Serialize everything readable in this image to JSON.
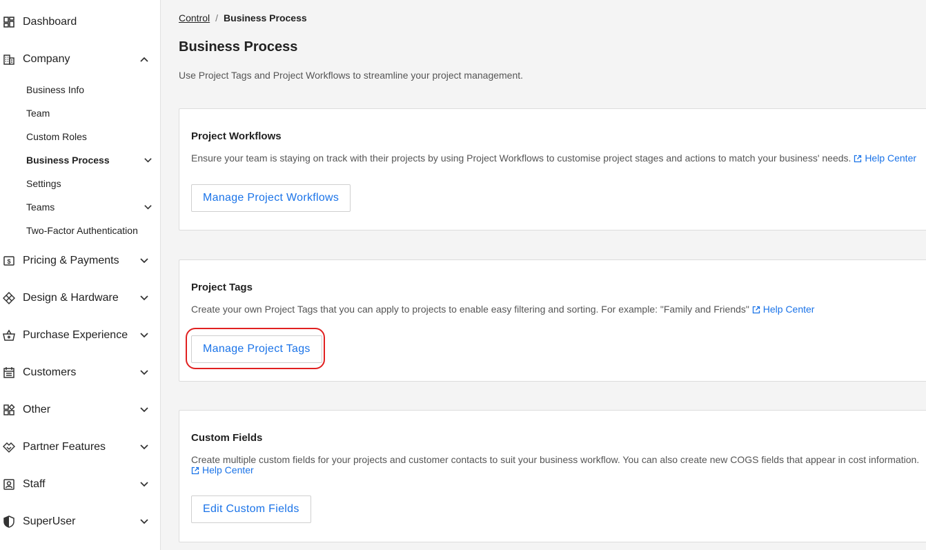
{
  "sidebar": {
    "items": [
      {
        "label": "Dashboard",
        "icon": "dashboard-icon"
      },
      {
        "label": "Company",
        "icon": "building-icon"
      },
      {
        "label": "Pricing & Payments",
        "icon": "dollar-icon"
      },
      {
        "label": "Design & Hardware",
        "icon": "diamond-grid-icon"
      },
      {
        "label": "Purchase Experience",
        "icon": "basket-icon"
      },
      {
        "label": "Customers",
        "icon": "calendar-list-icon"
      },
      {
        "label": "Other",
        "icon": "widgets-icon"
      },
      {
        "label": "Partner Features",
        "icon": "handshake-icon"
      },
      {
        "label": "Staff",
        "icon": "badge-icon"
      },
      {
        "label": "SuperUser",
        "icon": "shield-icon"
      }
    ],
    "company_sub": [
      {
        "label": "Business Info"
      },
      {
        "label": "Team"
      },
      {
        "label": "Custom Roles"
      },
      {
        "label": "Business Process"
      },
      {
        "label": "Settings"
      },
      {
        "label": "Teams"
      },
      {
        "label": "Two-Factor Authentication"
      }
    ]
  },
  "breadcrumb": {
    "parent": "Control",
    "separator": "/",
    "current": "Business Process"
  },
  "page": {
    "title": "Business Process",
    "description": "Use Project Tags and Project Workflows to streamline your project management."
  },
  "cards": {
    "workflows": {
      "title": "Project Workflows",
      "description": "Ensure your team is staying on track with their projects by using Project Workflows to customise project stages and actions to match your business' needs.",
      "help": "Help Center",
      "button": "Manage Project Workflows"
    },
    "tags": {
      "title": "Project Tags",
      "description": "Create your own Project Tags that you can apply to projects to enable easy filtering and sorting. For example: \"Family and Friends\"",
      "help": "Help Center",
      "button": "Manage Project Tags"
    },
    "fields": {
      "title": "Custom Fields",
      "description": "Create multiple custom fields for your projects and customer contacts to suit your business workflow. You can also create new COGS fields that appear in cost information.",
      "help": "Help Center",
      "button": "Edit Custom Fields"
    }
  },
  "colors": {
    "accent": "#1a73e8",
    "highlight": "#e02020",
    "background": "#f4f4f4"
  }
}
